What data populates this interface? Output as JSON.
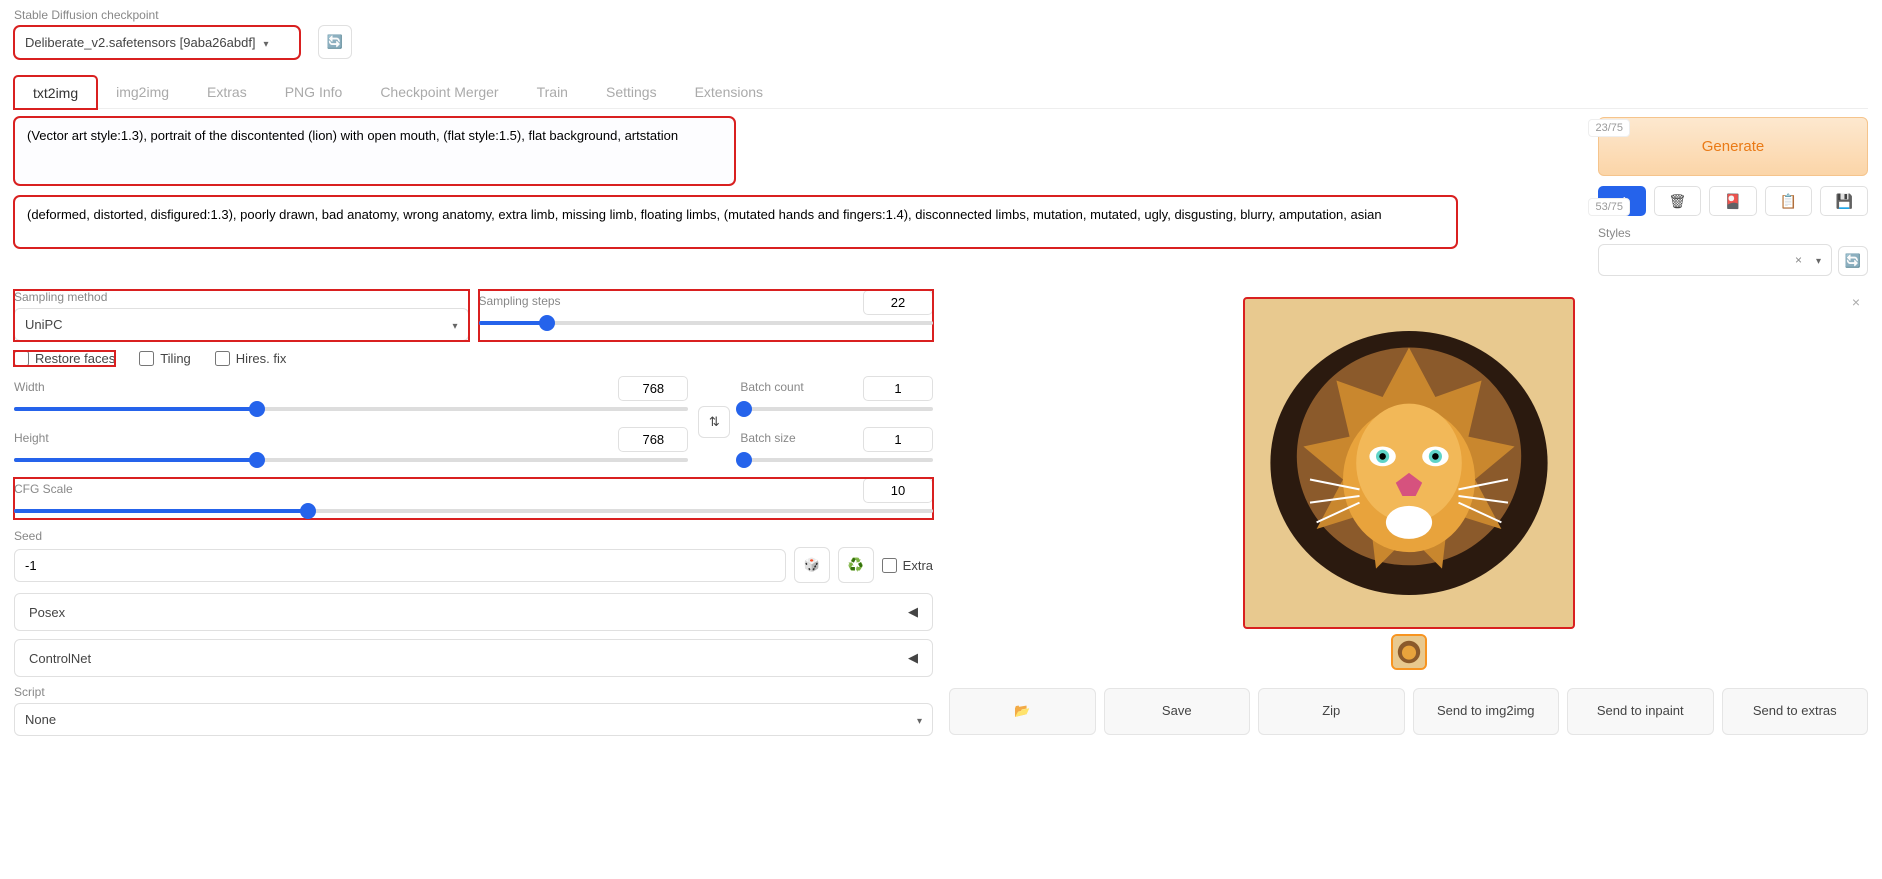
{
  "checkpoint": {
    "label": "Stable Diffusion checkpoint",
    "value": "Deliberate_v2.safetensors [9aba26abdf]"
  },
  "tabs": [
    "txt2img",
    "img2img",
    "Extras",
    "PNG Info",
    "Checkpoint Merger",
    "Train",
    "Settings",
    "Extensions"
  ],
  "active_tab": 0,
  "prompt": {
    "value": "(Vector art style:1.3), portrait of the discontented (lion) with open mouth, (flat style:1.5), flat background, artstation",
    "token_count": "23/75"
  },
  "neg_prompt": {
    "value": "(deformed, distorted, disfigured:1.3), poorly drawn, bad anatomy, wrong anatomy, extra limb, missing limb, floating limbs, (mutated hands and fingers:1.4), disconnected limbs, mutation, mutated, ugly, disgusting, blurry, amputation, asian",
    "token_count": "53/75"
  },
  "generate_label": "Generate",
  "styles_label": "Styles",
  "sampling": {
    "method_label": "Sampling method",
    "method_value": "UniPC",
    "steps_label": "Sampling steps",
    "steps_value": 22,
    "steps_max": 150
  },
  "checks": {
    "restore_faces": "Restore faces",
    "tiling": "Tiling",
    "hires_fix": "Hires. fix"
  },
  "dims": {
    "width_label": "Width",
    "width_value": 768,
    "height_label": "Height",
    "height_value": 768,
    "max": 2048
  },
  "batch": {
    "count_label": "Batch count",
    "count_value": 1,
    "size_label": "Batch size",
    "size_value": 1
  },
  "cfg": {
    "label": "CFG Scale",
    "value": 10,
    "max": 30
  },
  "seed": {
    "label": "Seed",
    "value": "-1",
    "extra_label": "Extra"
  },
  "accordions": {
    "posex": "Posex",
    "controlnet": "ControlNet"
  },
  "script": {
    "label": "Script",
    "value": "None"
  },
  "actions": {
    "folder": "📂",
    "save": "Save",
    "zip": "Zip",
    "send_img2img": "Send to img2img",
    "send_inpaint": "Send to inpaint",
    "send_extras": "Send to extras"
  },
  "icons": {
    "checkmark": "✓",
    "trash": "🗑",
    "card": "🎴",
    "clipboard": "📋",
    "disk": "💾",
    "dice": "🎲",
    "recycle": "♻️",
    "swap": "⇅",
    "close_x": "×",
    "clear_x": "×"
  }
}
